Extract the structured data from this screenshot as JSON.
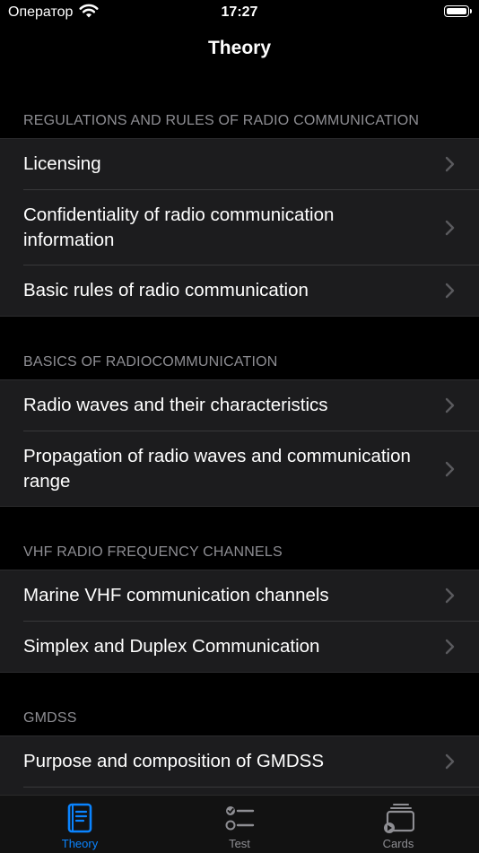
{
  "status_bar": {
    "carrier": "Оператор",
    "time": "17:27"
  },
  "nav": {
    "title": "Theory"
  },
  "sections": [
    {
      "header": "REGULATIONS AND RULES OF RADIO COMMUNICATION",
      "items": [
        {
          "label": "Licensing"
        },
        {
          "label": "Confidentiality of radio communication information"
        },
        {
          "label": "Basic rules of radio communication"
        }
      ]
    },
    {
      "header": "BASICS OF RADIOCOMMUNICATION",
      "items": [
        {
          "label": "Radio waves and their characteristics"
        },
        {
          "label": "Propagation of radio waves and communication range"
        }
      ]
    },
    {
      "header": "VHF RADIO FREQUENCY CHANNELS",
      "items": [
        {
          "label": "Marine VHF communication channels"
        },
        {
          "label": "Simplex and Duplex Communication"
        }
      ]
    },
    {
      "header": "GMDSS",
      "items": [
        {
          "label": "Purpose and composition of GMDSS"
        }
      ]
    }
  ],
  "tabs": [
    {
      "label": "Theory",
      "icon": "book-icon",
      "active": true
    },
    {
      "label": "Test",
      "icon": "checklist-icon",
      "active": false
    },
    {
      "label": "Cards",
      "icon": "cards-icon",
      "active": false
    }
  ],
  "colors": {
    "accent": "#0a84ff",
    "background": "#000000",
    "cell": "#1c1c1e",
    "secondary_text": "#8e8e93"
  }
}
